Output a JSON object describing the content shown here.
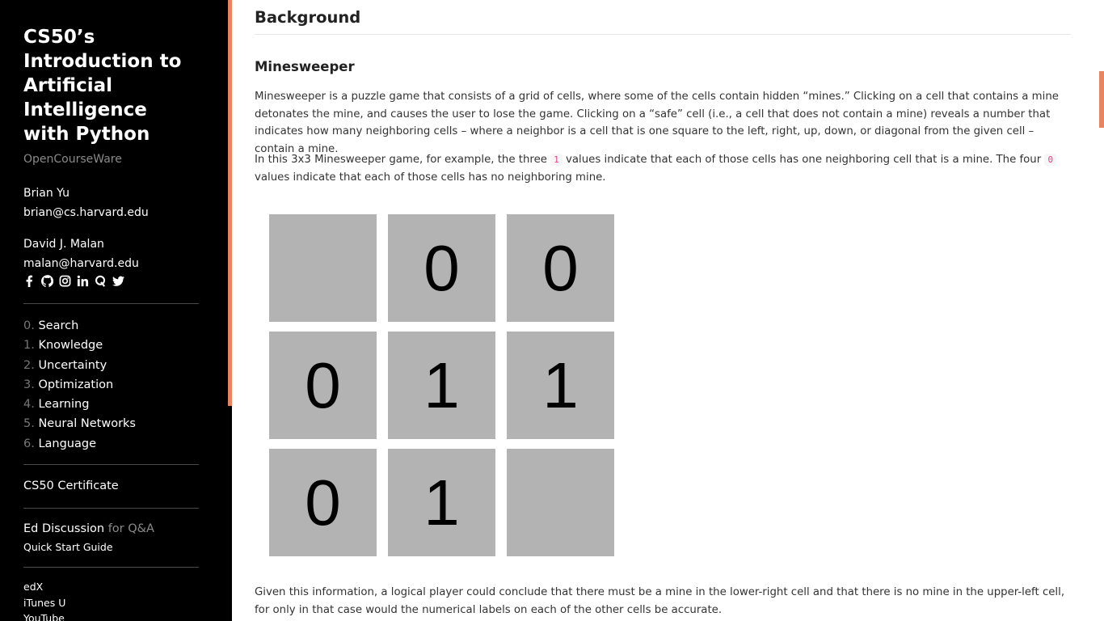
{
  "sidebar": {
    "course_title": "CS50’s Introduction to Artificial Intelligence with Python",
    "subtitle": "OpenCourseWare",
    "people": [
      {
        "name": "Brian Yu",
        "email": "brian@cs.harvard.edu"
      },
      {
        "name": "David J. Malan",
        "email": "malan@harvard.edu"
      }
    ],
    "social_icons": [
      "facebook-icon",
      "github-icon",
      "instagram-icon",
      "linkedin-icon",
      "quora-icon",
      "twitter-icon"
    ],
    "nav": [
      {
        "num": "0.",
        "label": "Search"
      },
      {
        "num": "1.",
        "label": "Knowledge"
      },
      {
        "num": "2.",
        "label": "Uncertainty"
      },
      {
        "num": "3.",
        "label": "Optimization"
      },
      {
        "num": "4.",
        "label": "Learning"
      },
      {
        "num": "5.",
        "label": "Neural Networks"
      },
      {
        "num": "6.",
        "label": "Language"
      }
    ],
    "certificate": "CS50 Certificate",
    "ed_discussion": "Ed Discussion",
    "ed_suffix": "for Q&A",
    "quick_start": "Quick Start Guide",
    "links": [
      "edX",
      "iTunes U",
      "YouTube"
    ]
  },
  "main": {
    "section_title": "Background",
    "subsection_title": "Minesweeper",
    "para1": "Minesweeper is a puzzle game that consists of a grid of cells, where some of the cells contain hidden “mines.” Clicking on a cell that contains a mine detonates the mine, and causes the user to lose the game. Clicking on a “safe” cell (i.e., a cell that does not contain a mine) reveals a number that indicates how many neighboring cells – where a neighbor is a cell that is one square to the left, right, up, down, or diagonal from the given cell – contain a mine.",
    "para2_a": "In this 3x3 Minesweeper game, for example, the three",
    "para2_code1": "1",
    "para2_b": "values indicate that each of those cells has one neighboring cell that is a mine. The four",
    "para2_code2": "0",
    "para2_c": "values indicate that each of those cells has no neighboring mine.",
    "grid": [
      "",
      "0",
      "0",
      "0",
      "1",
      "1",
      "0",
      "1",
      ""
    ],
    "para3": "Given this information, a logical player could conclude that there must be a mine in the lower-right cell and that there is no mine in the upper-left cell, for only in that case would the numerical labels on each of the other cells be accurate."
  },
  "colors": {
    "accent": "#e8845f",
    "sidebar_bg": "#000000",
    "cell_bg": "#b3b3b3",
    "code": "#e83e8c"
  }
}
